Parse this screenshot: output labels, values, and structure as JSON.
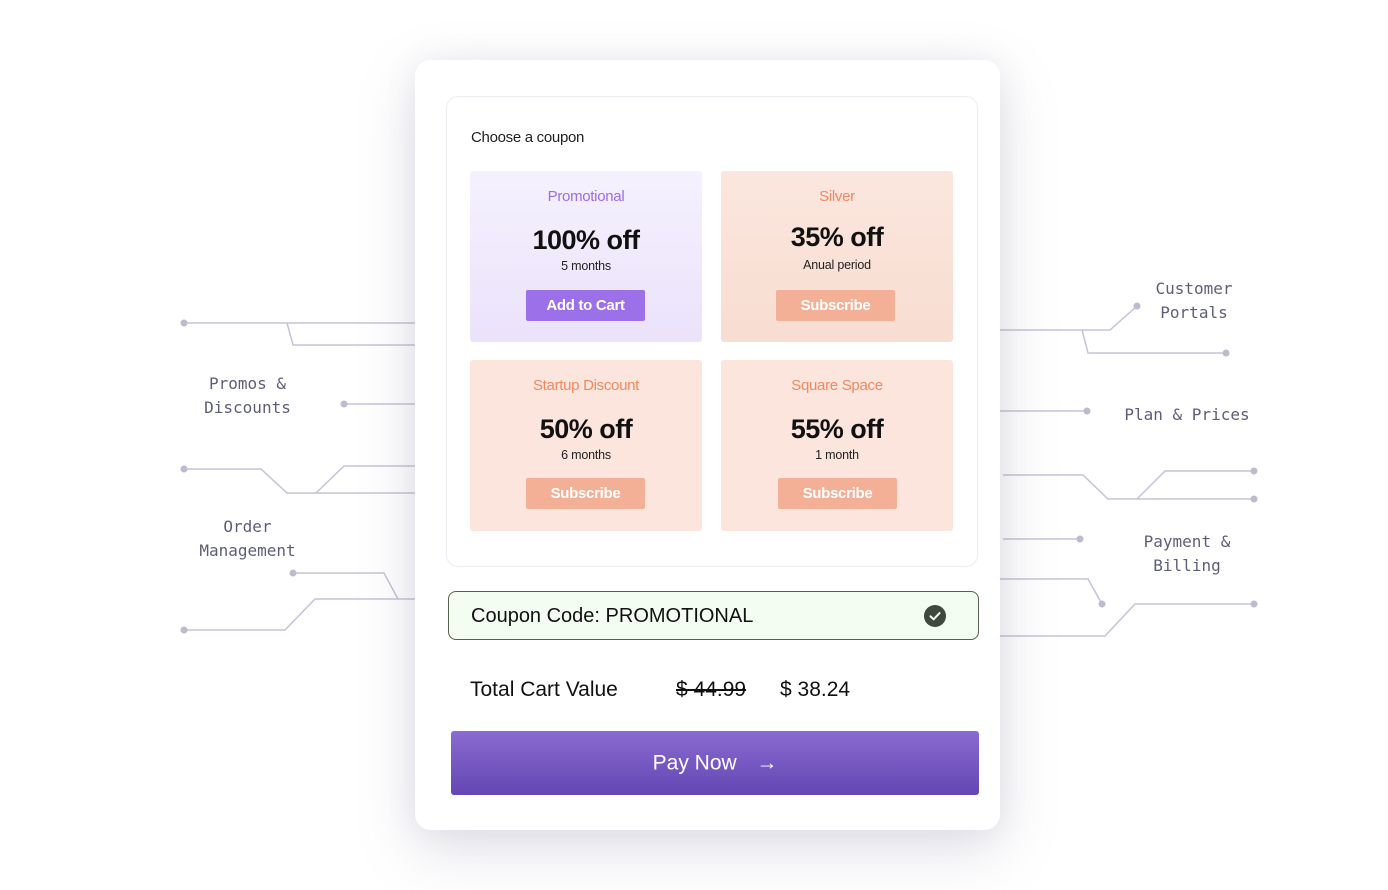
{
  "side_labels": {
    "left": [
      "Promos &\nDiscounts",
      "Order\nManagement"
    ],
    "right": [
      "Customer\nPortals",
      "Plan & Prices",
      "Payment &\nBilling"
    ]
  },
  "coupon_panel": {
    "title": "Choose a coupon",
    "coupons": [
      {
        "name": "Promotional",
        "discount": "100% off",
        "period": "5 months",
        "button": "Add to Cart",
        "selected": true
      },
      {
        "name": "Silver",
        "discount": "35% off",
        "period": "Anual period",
        "button": "Subscribe",
        "selected": false
      },
      {
        "name": "Startup Discount",
        "discount": "50% off",
        "period": "6 months",
        "button": "Subscribe",
        "selected": false
      },
      {
        "name": "Square Space",
        "discount": "55% off",
        "period": "1 month",
        "button": "Subscribe",
        "selected": false
      }
    ]
  },
  "coupon_code": {
    "text": "Coupon Code: PROMOTIONAL",
    "status_icon": "check-circle-icon"
  },
  "cart": {
    "label": "Total Cart Value",
    "original_price": "$ 44.99",
    "discounted_price": "$ 38.24"
  },
  "pay_button": {
    "label": "Pay Now",
    "icon": "→"
  },
  "colors": {
    "accent_purple": "#9b70e8",
    "pay_gradient_top": "#8a6bd1",
    "pay_gradient_bottom": "#6446b4",
    "peach_button": "#f3b096",
    "coupon_valid_bg": "#f4fdf1"
  }
}
